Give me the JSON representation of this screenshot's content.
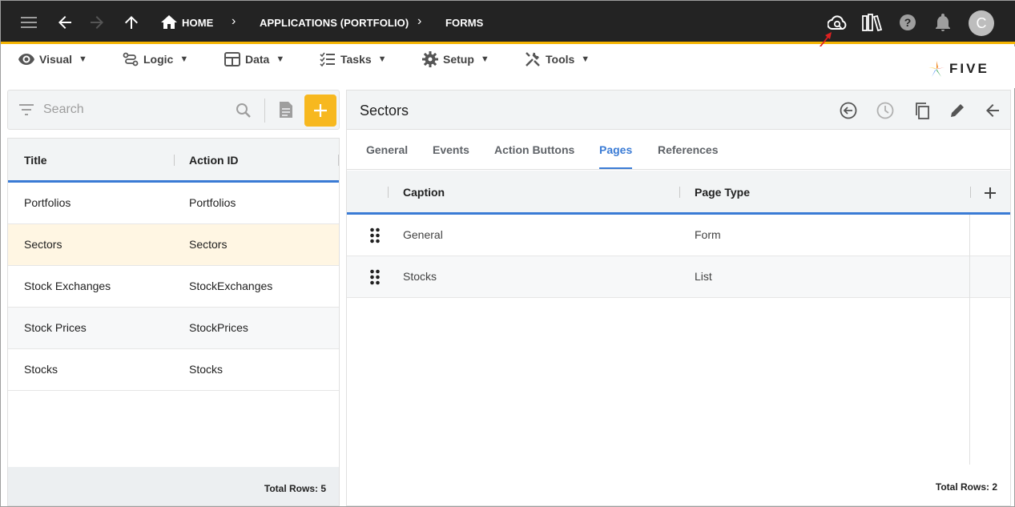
{
  "topbar": {
    "breadcrumbs": [
      "HOME",
      "APPLICATIONS (PORTFOLIO)",
      "FORMS"
    ],
    "avatar_initial": "C"
  },
  "menubar": {
    "items": [
      {
        "label": "Visual",
        "icon": "eye-icon"
      },
      {
        "label": "Logic",
        "icon": "flow-icon"
      },
      {
        "label": "Data",
        "icon": "table-icon"
      },
      {
        "label": "Tasks",
        "icon": "checklist-icon"
      },
      {
        "label": "Setup",
        "icon": "gear-icon"
      },
      {
        "label": "Tools",
        "icon": "wrench-icon"
      }
    ],
    "caret": "▼",
    "logo_text": "FIVE"
  },
  "left": {
    "search_placeholder": "Search",
    "columns": [
      "Title",
      "Action ID"
    ],
    "rows": [
      {
        "title": "Portfolios",
        "action_id": "Portfolios"
      },
      {
        "title": "Sectors",
        "action_id": "Sectors"
      },
      {
        "title": "Stock Exchanges",
        "action_id": "StockExchanges"
      },
      {
        "title": "Stock Prices",
        "action_id": "StockPrices"
      },
      {
        "title": "Stocks",
        "action_id": "Stocks"
      }
    ],
    "total_rows": "Total Rows: 5"
  },
  "right": {
    "title": "Sectors",
    "tabs": [
      "General",
      "Events",
      "Action Buttons",
      "Pages",
      "References"
    ],
    "active_tab": "Pages",
    "columns": [
      "Caption",
      "Page Type"
    ],
    "rows": [
      {
        "caption": "General",
        "page_type": "Form"
      },
      {
        "caption": "Stocks",
        "page_type": "List"
      }
    ],
    "total_rows": "Total Rows: 2"
  },
  "colors": {
    "accent": "#3a7bd5",
    "highlight": "#f7b81f",
    "topbar": "#232323",
    "selected_row": "#fff6e3"
  }
}
